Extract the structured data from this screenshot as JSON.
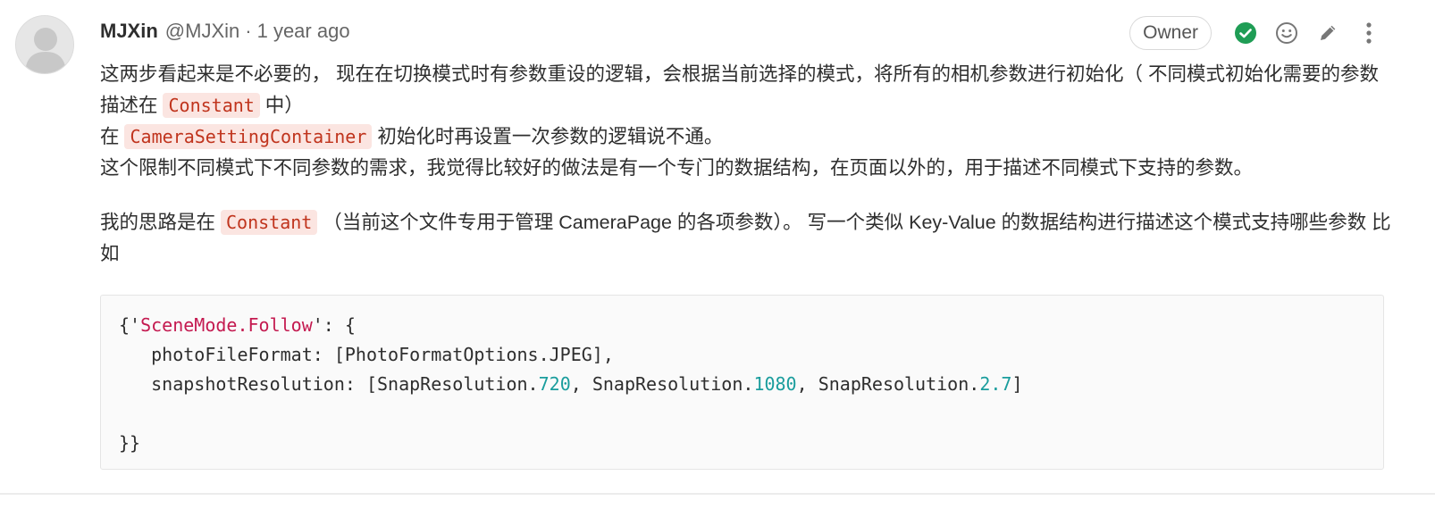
{
  "author": {
    "name": "MJXin",
    "handle": "@MJXin",
    "separator": "·",
    "time": "1 year ago"
  },
  "badge": {
    "label": "Owner"
  },
  "icons": {
    "resolved": "check-circle-icon",
    "emoji": "smiley-icon",
    "edit": "pencil-icon",
    "more": "more-vertical-icon"
  },
  "colors": {
    "resolved": "#1f9d55",
    "inline_code_bg": "#fbe5e1",
    "inline_code_fg": "#c0341d",
    "code_string": "#c41a50",
    "code_number": "#1a9d9d"
  },
  "body": {
    "p1": {
      "t1": "这两步看起来是不必要的， 现在在切换模式时有参数重设的逻辑，会根据当前选择的模式，将所有的相机参数进行初始化（ 不同模式初始化需要的参数描述在 ",
      "code1": "Constant",
      "t2": " 中）",
      "t3": "在 ",
      "code2": "CameraSettingContainer",
      "t4": " 初始化时再设置一次参数的逻辑说不通。",
      "t5": "这个限制不同模式下不同参数的需求，我觉得比较好的做法是有一个专门的数据结构，在页面以外的，用于描述不同模式下支持的参数。"
    },
    "p2": {
      "t1": "我的思路是在 ",
      "code1": "Constant",
      "t2": " （当前这个文件专用于管理 CameraPage 的各项参数）。 写一个类似 Key-Value 的数据结构进行描述这个模式支持哪些参数 比如"
    }
  },
  "code": {
    "l1_open": "{'",
    "l1_key": "SceneMode.Follow",
    "l1_close": "': {",
    "l2": "   photoFileFormat: [PhotoFormatOptions.JPEG],",
    "l3_a": "   snapshotResolution: [SnapResolution.",
    "l3_n1": "720",
    "l3_b": ", SnapResolution.",
    "l3_n2": "1080",
    "l3_c": ", SnapResolution.",
    "l3_n3": "2.7",
    "l3_d": "]",
    "l4": "",
    "l5": "}}"
  }
}
